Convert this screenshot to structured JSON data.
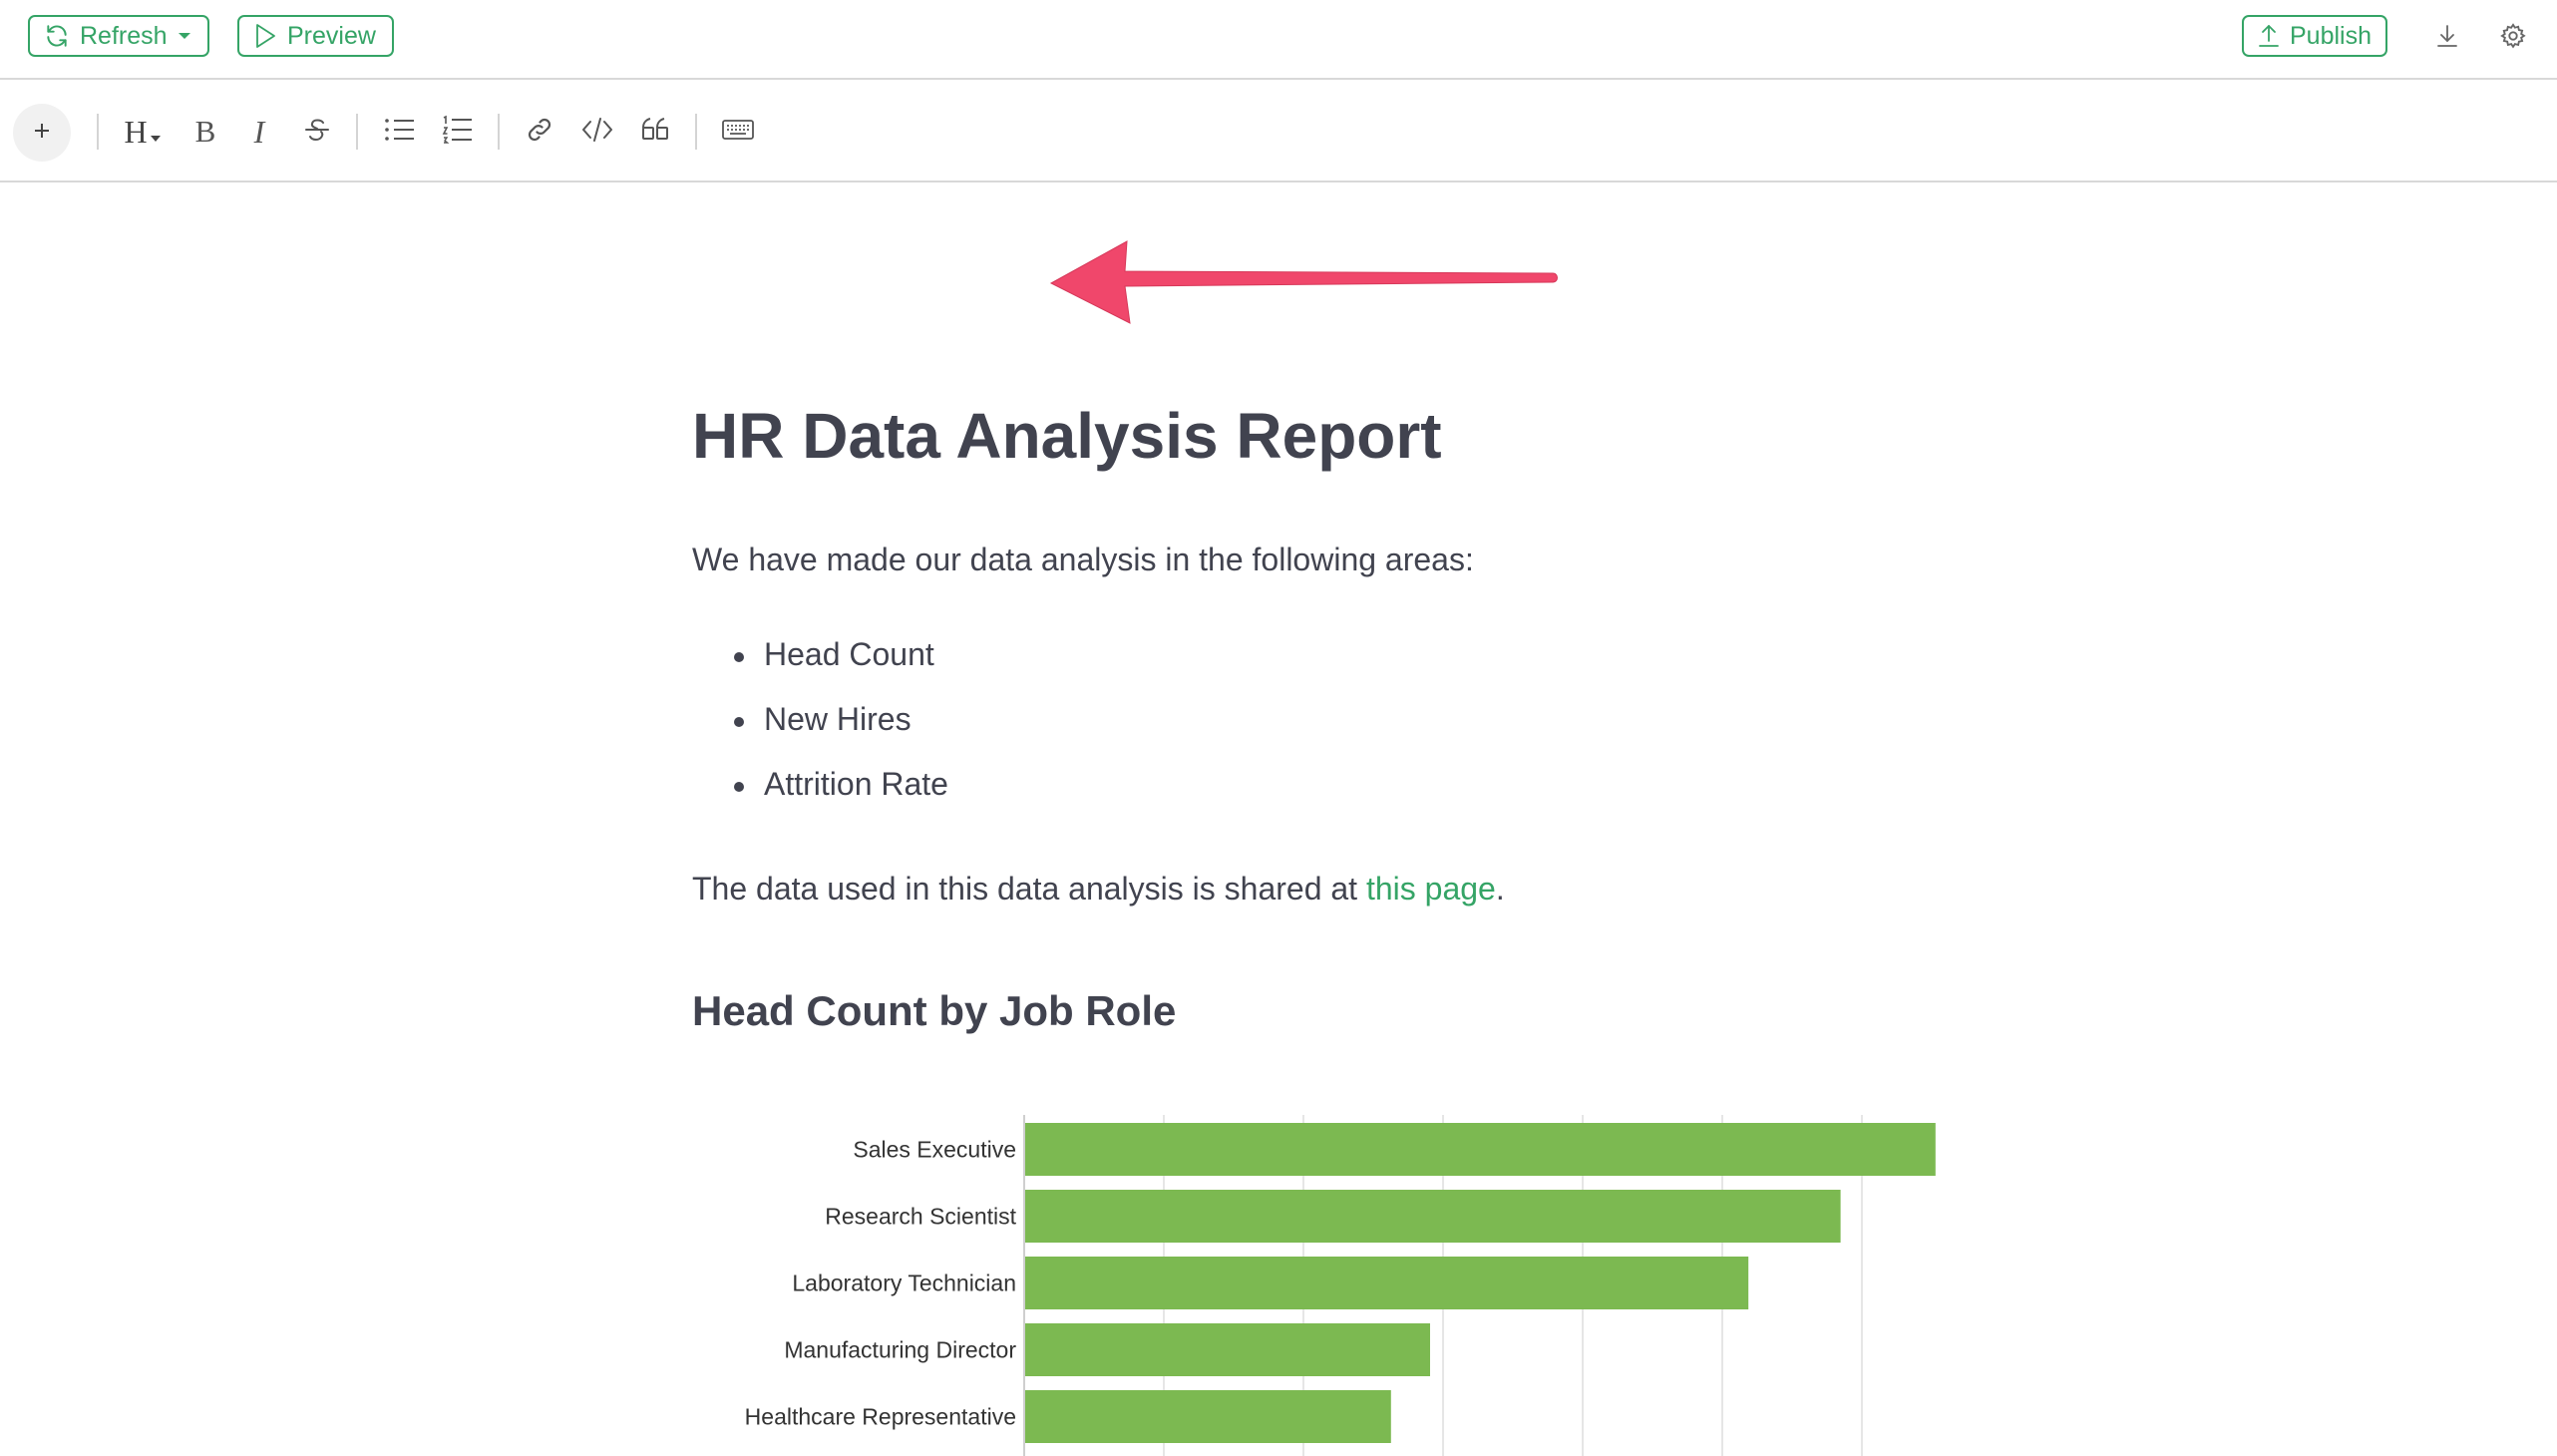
{
  "topbar": {
    "refresh_label": "Refresh",
    "preview_label": "Preview",
    "publish_label": "Publish"
  },
  "toolbar": {
    "heading_label": "H",
    "bold_label": "B",
    "italic_label": "I"
  },
  "doc": {
    "title": "HR Data Analysis Report",
    "intro": "We have made our data analysis in the following areas:",
    "bullets": [
      "Head Count",
      "New Hires",
      "Attrition Rate"
    ],
    "shared_prefix": "The data used in this data analysis is shared at ",
    "shared_link": "this page",
    "shared_suffix": ".",
    "section_title": "Head Count by Job Role"
  },
  "colors": {
    "accent": "#35a466",
    "bar": "#7cb951",
    "arrow": "#f0476b",
    "text": "#41434f"
  },
  "chart_data": {
    "type": "bar",
    "orientation": "horizontal",
    "categories": [
      "Sales Executive",
      "Research Scientist",
      "Laboratory Technician",
      "Manufacturing Director",
      "Healthcare Representative"
    ],
    "values": [
      326,
      292,
      259,
      145,
      131
    ],
    "xlim": [
      0,
      350
    ],
    "grid": true
  }
}
